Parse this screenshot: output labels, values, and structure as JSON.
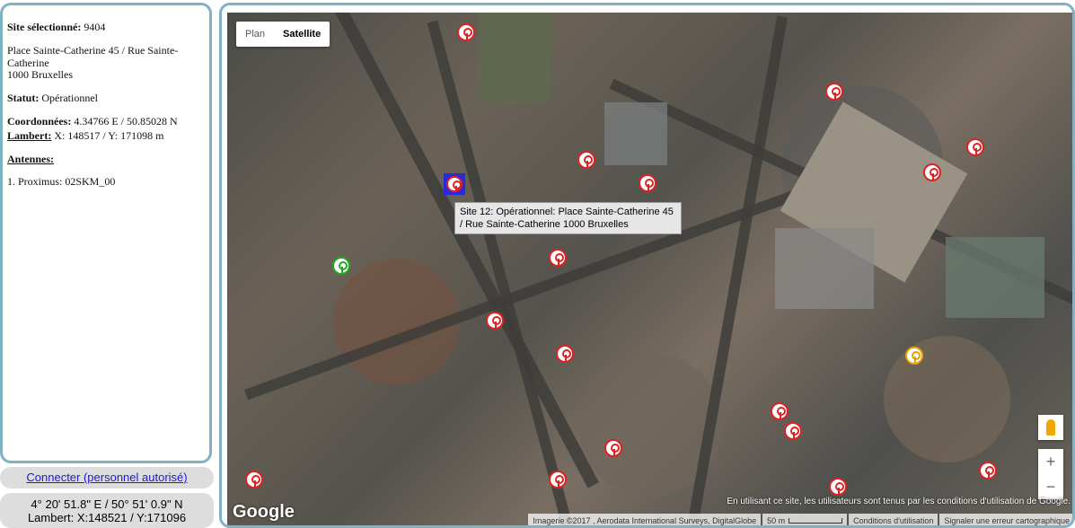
{
  "info": {
    "site_label": "Site sélectionné:",
    "site_value": "9404",
    "address_line1": "Place Sainte-Catherine 45 / Rue Sainte-Catherine",
    "address_line2": "1000 Bruxelles",
    "status_label": "Statut:",
    "status_value": "Opérationnel",
    "coords_label": "Coordonnées:",
    "coords_value": "4.34766 E / 50.85028 N",
    "lambert_label": "Lambert:",
    "lambert_value": "X: 148517 / Y: 171098 m",
    "antennas_label": "Antennes:",
    "antennas": [
      "1. Proximus: 02SKM_00"
    ]
  },
  "connect_link": "Connecter (personnel autorisé)",
  "cursor_coords": {
    "line1": "4° 20' 51.8\" E / 50° 51' 0.9\" N",
    "line2": "Lambert: X:148521 / Y:171096"
  },
  "map": {
    "type_plan": "Plan",
    "type_satellite": "Satellite",
    "selected_type": "Satellite",
    "tooltip": "Site 12: Opérationnel: Place Sainte-Catherine 45 / Rue Sainte-Catherine 1000 Bruxelles",
    "google_logo": "Google",
    "terms_notice": "En utilisant ce site, les utilisateurs sont tenus par les conditions d'utilisation de Google.",
    "imagery": "Imagerie ©2017 , Aerodata International Surveys, DigitalGlobe",
    "scale_label": "50 m",
    "terms_link": "Conditions d'utilisation",
    "report_link": "Signaler une erreur cartographique",
    "zoom_in": "+",
    "zoom_out": "−",
    "colors": {
      "marker_default": "#d22222",
      "marker_green": "#22aa22",
      "marker_yellow": "#e8a100",
      "selection": "#2a2ad8",
      "panel_border": "#7fb3c4"
    }
  }
}
